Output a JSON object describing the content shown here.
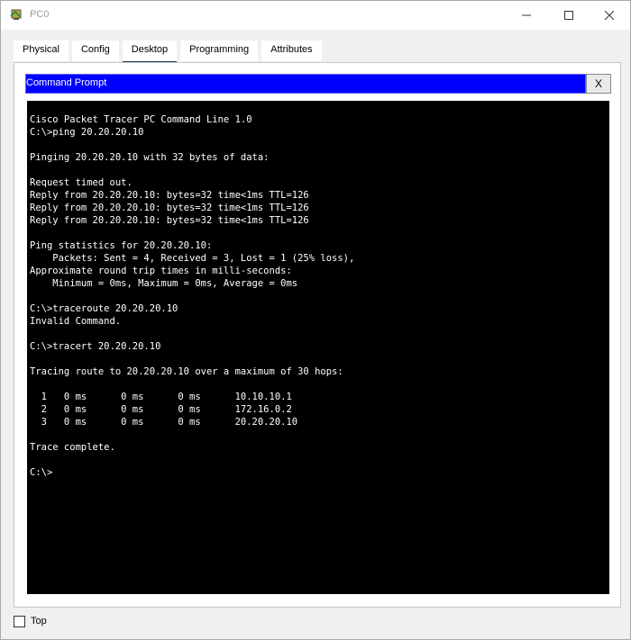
{
  "window": {
    "title": "PC0",
    "controls": {
      "minimize": "minimize-icon",
      "maximize": "maximize-icon",
      "close": "close-icon"
    }
  },
  "tabs": [
    {
      "label": "Physical",
      "active": false
    },
    {
      "label": "Config",
      "active": false
    },
    {
      "label": "Desktop",
      "active": true
    },
    {
      "label": "Programming",
      "active": false
    },
    {
      "label": "Attributes",
      "active": false
    }
  ],
  "command_prompt": {
    "title": "Command Prompt",
    "close_label": "X",
    "header_color": "#0000ff",
    "lines": [
      "Cisco Packet Tracer PC Command Line 1.0",
      "C:\\>ping 20.20.20.10",
      "",
      "Pinging 20.20.20.10 with 32 bytes of data:",
      "",
      "Request timed out.",
      "Reply from 20.20.20.10: bytes=32 time<1ms TTL=126",
      "Reply from 20.20.20.10: bytes=32 time<1ms TTL=126",
      "Reply from 20.20.20.10: bytes=32 time<1ms TTL=126",
      "",
      "Ping statistics for 20.20.20.10:",
      "    Packets: Sent = 4, Received = 3, Lost = 1 (25% loss),",
      "Approximate round trip times in milli-seconds:",
      "    Minimum = 0ms, Maximum = 0ms, Average = 0ms",
      "",
      "C:\\>traceroute 20.20.20.10",
      "Invalid Command.",
      "",
      "C:\\>tracert 20.20.20.10",
      "",
      "Tracing route to 20.20.20.10 over a maximum of 30 hops:",
      "",
      "  1   0 ms      0 ms      0 ms      10.10.10.1",
      "  2   0 ms      0 ms      0 ms      172.16.0.2",
      "  3   0 ms      0 ms      0 ms      20.20.20.10",
      "",
      "Trace complete.",
      "",
      "C:\\>"
    ]
  },
  "bottom": {
    "top_label": "Top",
    "top_checked": false
  }
}
